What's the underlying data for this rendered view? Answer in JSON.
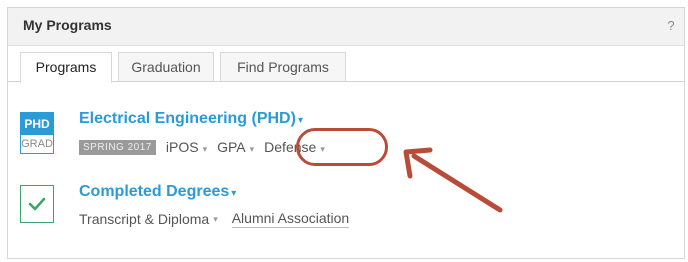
{
  "panel": {
    "title": "My Programs",
    "help_icon": "?"
  },
  "tabs": [
    {
      "label": "Programs",
      "active": true
    },
    {
      "label": "Graduation",
      "active": false
    },
    {
      "label": "Find Programs",
      "active": false
    }
  ],
  "program": {
    "badge_top": "PHD",
    "badge_bottom": "GRAD",
    "title": "Electrical Engineering (PHD)",
    "title_chevron": "⌄",
    "term": "SPRING 2017",
    "items": [
      {
        "label": "iPOS"
      },
      {
        "label": "GPA"
      },
      {
        "label": "Defense"
      }
    ],
    "highlight_color": "#b84c38"
  },
  "completed": {
    "title": "Completed Degrees",
    "chevron": "⌄",
    "links": [
      {
        "label": "Transcript & Diploma"
      },
      {
        "label": "Alumni Association"
      }
    ]
  },
  "colors": {
    "accent": "#2b9bd8",
    "success": "#3aa56b",
    "annotation": "#b84c38"
  }
}
